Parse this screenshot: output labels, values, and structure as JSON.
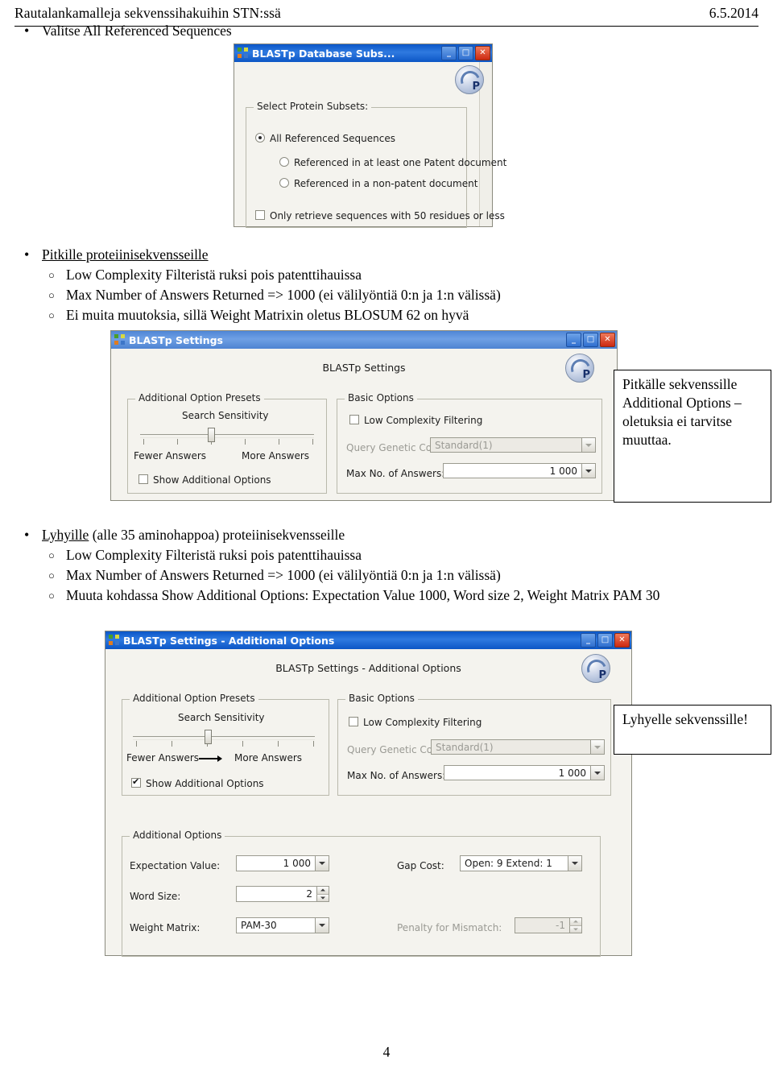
{
  "header": {
    "left": "Rautalankamalleja sekvenssihakuihin STN:ssä",
    "right": "6.5.2014"
  },
  "bullets": {
    "select_all_referenced": "Valitse All Referenced Sequences",
    "pitkille_title": "Pitkille proteiinisekvensseille",
    "pitkille_items": [
      "Low Complexity Filteristä ruksi pois patenttihauissa",
      "Max Number of Answers Returned => 1000 (ei välilyöntiä 0:n ja 1:n välissä)",
      "Ei muita muutoksia, sillä Weight Matrixin oletus BLOSUM 62 on hyvä"
    ],
    "lyhyille_title_link": "Lyhyille",
    "lyhyille_title_rest": " (alle 35 aminohappoa) proteiinisekvensseille",
    "lyhyille_items": [
      "Low Complexity Filteristä ruksi pois patenttihauissa",
      "Max Number of Answers Returned => 1000 (ei välilyöntiä 0:n ja 1:n välissä)",
      "Muuta kohdassa Show Additional Options: Expectation Value  1000, Word size 2, Weight Matrix PAM 30"
    ]
  },
  "callouts": {
    "pitkalle": "Pitkälle sekvenssille Additional Options – oletuksia ei tarvitse muuttaa.",
    "lyhyelle": "Lyhyelle sekvenssille!"
  },
  "dialog_subsets": {
    "title": "BLASTp Database Subs...",
    "group_label": "Select Protein Subsets:",
    "options": [
      "All Referenced Sequences",
      "Referenced in at least one Patent document",
      "Referenced in a non-patent document"
    ],
    "checkbox": "Only retrieve sequences with 50 residues or less",
    "buttons": {
      "minimize": "_",
      "maximize": "□",
      "close": "✕"
    }
  },
  "dialog_settings": {
    "title": "BLASTp Settings",
    "panel_heading": "BLASTp Settings",
    "presets_group": "Additional Option Presets",
    "search_sensitivity": "Search Sensitivity",
    "fewer_answers": "Fewer Answers",
    "more_answers": "More Answers",
    "show_additional_options": "Show Additional Options",
    "basic_group": "Basic Options",
    "low_complexity": "Low Complexity Filtering",
    "query_genetic_code_label": "Query Genetic Code:",
    "query_genetic_code_value": "Standard(1)",
    "max_answers_label": "Max No. of Answers:",
    "max_answers_value": "1 000"
  },
  "dialog_settings_additional": {
    "title": "BLASTp Settings - Additional Options",
    "panel_heading": "BLASTp Settings - Additional Options",
    "presets_group": "Additional Option Presets",
    "search_sensitivity": "Search Sensitivity",
    "fewer_answers": "Fewer Answers",
    "more_answers": "More Answers",
    "show_additional_options": "Show Additional Options",
    "basic_group": "Basic Options",
    "low_complexity": "Low Complexity Filtering",
    "query_genetic_code_label": "Query Genetic Code:",
    "query_genetic_code_value": "Standard(1)",
    "max_answers_label": "Max No. of Answers:",
    "max_answers_value": "1 000",
    "additional_group": "Additional Options",
    "expectation_label": "Expectation Value:",
    "expectation_value": "1 000",
    "word_size_label": "Word Size:",
    "word_size_value": "2",
    "weight_matrix_label": "Weight Matrix:",
    "weight_matrix_value": "PAM-30",
    "gap_cost_label": "Gap Cost:",
    "gap_cost_value": "Open: 9  Extend: 1",
    "penalty_label": "Penalty for Mismatch:",
    "penalty_value": "-1"
  },
  "footer": {
    "page_number": "4"
  }
}
